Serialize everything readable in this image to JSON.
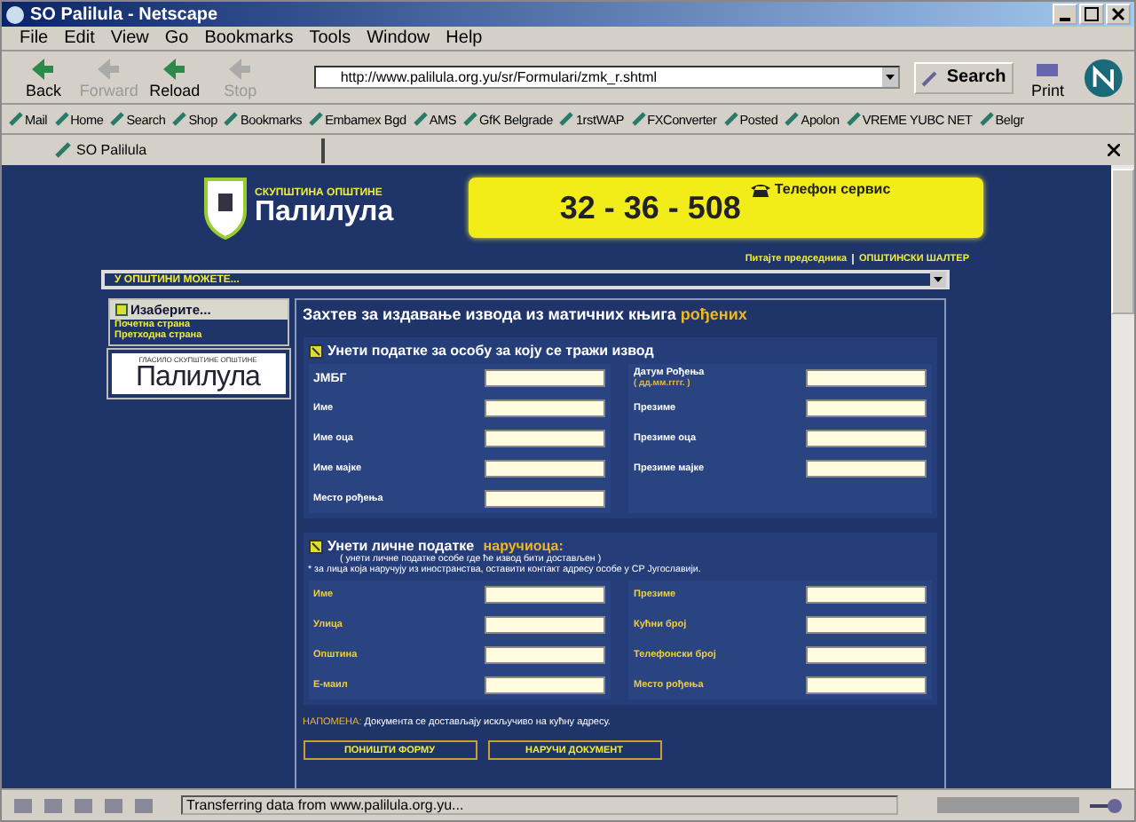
{
  "window": {
    "title": "SO Palilula - Netscape"
  },
  "menu": [
    "File",
    "Edit",
    "View",
    "Go",
    "Bookmarks",
    "Tools",
    "Window",
    "Help"
  ],
  "nav_buttons": [
    {
      "label": "Back",
      "disabled": false
    },
    {
      "label": "Forward",
      "disabled": true
    },
    {
      "label": "Reload",
      "disabled": false
    },
    {
      "label": "Stop",
      "disabled": true
    }
  ],
  "address": {
    "value": "http://www.palilula.org.yu/sr/Formulari/zmk_r.shtml"
  },
  "search_button": "Search",
  "print_button": "Print",
  "personal_toolbar": [
    "Mail",
    "Home",
    "Search",
    "Shop",
    "Bookmarks",
    "Embamex Bgd",
    "AMS",
    "GfK Belgrade",
    "1rstWAP",
    "FXConverter",
    "Posted",
    "Apolon",
    "VREME YUBC NET",
    "Belgr"
  ],
  "tab": {
    "label": "SO Palilula"
  },
  "page": {
    "logo": {
      "subtitle": "СКУПШТИНА ОПШТИНЕ",
      "name": "Палилула"
    },
    "phone": {
      "number": "32 - 36 - 508",
      "label": "Телефон сервис"
    },
    "top_links": [
      "Питајте председника",
      "ОПШТИНСКИ ШАЛТЕР"
    ],
    "dropdown": {
      "value": "У ОПШТИНИ МОЖЕТЕ..."
    },
    "sidebar": {
      "heading": "Изаберите...",
      "links": [
        "Почетна страна",
        "Претходна страна"
      ],
      "banner": {
        "caption": "ГЛАСИЛО СКУПШТИНЕ ОПШТИНЕ",
        "name": "Палилула"
      }
    },
    "form": {
      "title": "Захтев за издавање извода из матичних књига",
      "title_highlight": "рођених",
      "sections": [
        {
          "heading": "Унети податке за особу за коју се тражи извод",
          "labels_highlighted": false,
          "left": [
            {
              "label": "ЈМБГ"
            },
            {
              "label": "Име"
            },
            {
              "label": "Име оца"
            },
            {
              "label": "Име мајке"
            },
            {
              "label": "Место рођења"
            }
          ],
          "right": [
            {
              "label": "Датум Рођења",
              "hint": "( дд.мм.гггг. )"
            },
            {
              "label": "Презиме"
            },
            {
              "label": "Презиме оца"
            },
            {
              "label": "Презиме мајке"
            }
          ]
        },
        {
          "heading": "Унети личне податке",
          "heading_highlight": "наручиоца:",
          "notes": [
            "( унети личне податке особе где ће извод бити достављен )",
            "* за лица која наручују из иностранства, оставити контакт адресу особе у СР Југославији."
          ],
          "labels_highlighted": true,
          "left": [
            {
              "label": "Име"
            },
            {
              "label": "Улица"
            },
            {
              "label": "Општина"
            },
            {
              "label": "Е-маил"
            }
          ],
          "right": [
            {
              "label": "Презиме"
            },
            {
              "label": "Кућни број"
            },
            {
              "label": "Телефонски број"
            },
            {
              "label": "Место рођења"
            }
          ]
        }
      ],
      "note_label": "НАПОМЕНА:",
      "note": "Документа се достављају искључиво на кућну адресу.",
      "buttons": [
        "ПОНИШТИ ФОРМУ",
        "НАРУЧИ ДОКУМЕНТ"
      ]
    }
  },
  "status_bar": {
    "text": "Transferring data from www.palilula.org.yu..."
  }
}
